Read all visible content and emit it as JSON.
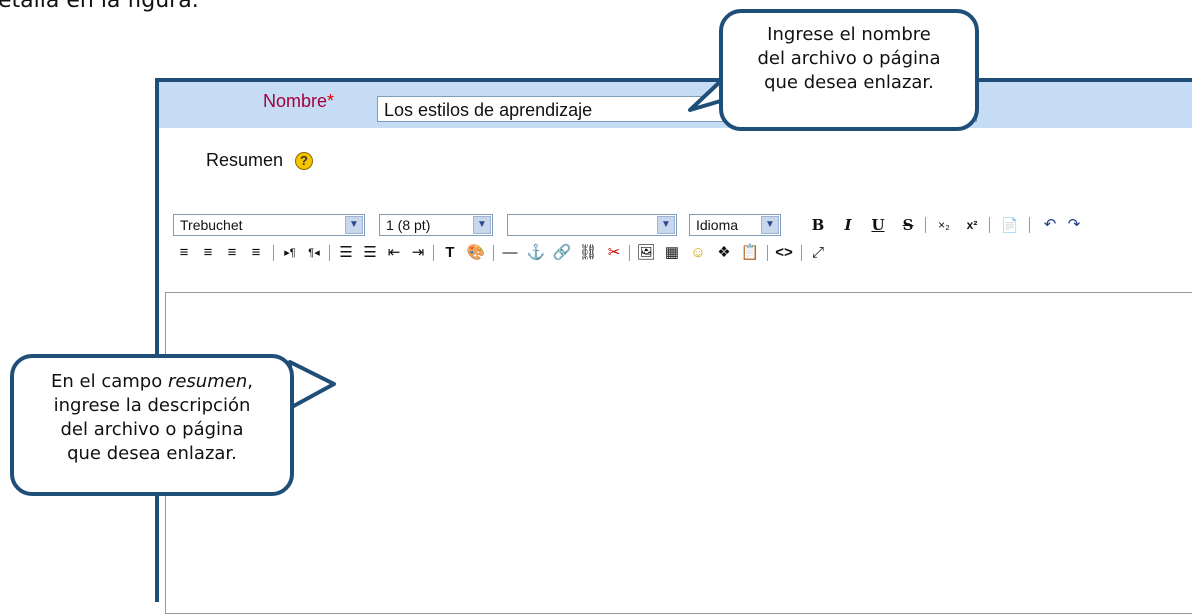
{
  "heading_fragment": "etalla en la figura.",
  "form": {
    "name_label": "Nombre",
    "required_mark": "*",
    "name_value": "Los estilos de aprendizaje",
    "summary_label": "Resumen",
    "help_icon_glyph": "?"
  },
  "toolbar": {
    "font_family": "Trebuchet",
    "font_size": "1 (8 pt)",
    "format": "",
    "language": "Idioma",
    "buttons_row1": [
      "B",
      "I",
      "U",
      "S",
      "×₂",
      "x²",
      "📄",
      "↶",
      "↷"
    ],
    "buttons_row2": [
      "≡",
      "≡",
      "≡",
      "≡",
      "▸¶",
      "¶◂",
      "☰",
      "☰",
      "⇤",
      "⇥",
      "T",
      "🎨",
      "—",
      "⚓",
      "🔗",
      "⛓",
      "✂",
      "🖼",
      "▦",
      "☺",
      "❖",
      "📋",
      "<>",
      "⤢"
    ]
  },
  "callouts": {
    "name_tip": [
      "Ingrese el nombre",
      "del archivo o página",
      "que desea enlazar."
    ],
    "summary_tip_prefix": "En el campo ",
    "summary_tip_em": "resumen",
    "summary_tip_suffix": ",",
    "summary_tip_lines": [
      "ingrese la descripción",
      "del archivo o página",
      "que desea enlazar."
    ]
  }
}
